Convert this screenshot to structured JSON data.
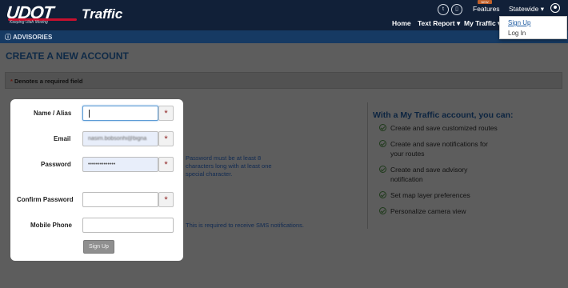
{
  "brand": {
    "logo_text": "UDOT",
    "tagline": "Keeping Utah Moving",
    "app_name": "Traffic"
  },
  "topbar": {
    "features_label": "Features",
    "new_badge": "NEW",
    "region_label": "Statewide ▾"
  },
  "menu": {
    "home": "Home",
    "text_report": "Text Report ▾",
    "my_traffic": "My Traffic ▾"
  },
  "dropdown": {
    "sign_up": "Sign Up",
    "log_in": "Log In"
  },
  "advisories": {
    "icon": "info-circle-icon",
    "label": "ADVISORIES"
  },
  "page": {
    "title": "CREATE A NEW ACCOUNT",
    "required_star": "*",
    "required_note": "Denotes a required field"
  },
  "form": {
    "name_label": "Name / Alias",
    "name_value": "",
    "email_label": "Email",
    "email_value": "nasim.bobsonhi@bigna",
    "password_label": "Password",
    "password_value": "••••••••••••••",
    "confirm_label": "Confirm Password",
    "confirm_value": "",
    "mobile_label": "Mobile Phone",
    "mobile_value": "",
    "required_mark": "*",
    "submit_label": "Sign Up",
    "password_help": "Password must be at least 8 characters long with at least one special character.",
    "mobile_help": "This is required to receive SMS notifications."
  },
  "side": {
    "title": "With a My Traffic account, you can:",
    "benefits": [
      "Create and save customized routes",
      "Create and save notifications for your routes",
      "Create and save advisory notification",
      "Set map layer preferences",
      "Personalize camera view"
    ]
  }
}
